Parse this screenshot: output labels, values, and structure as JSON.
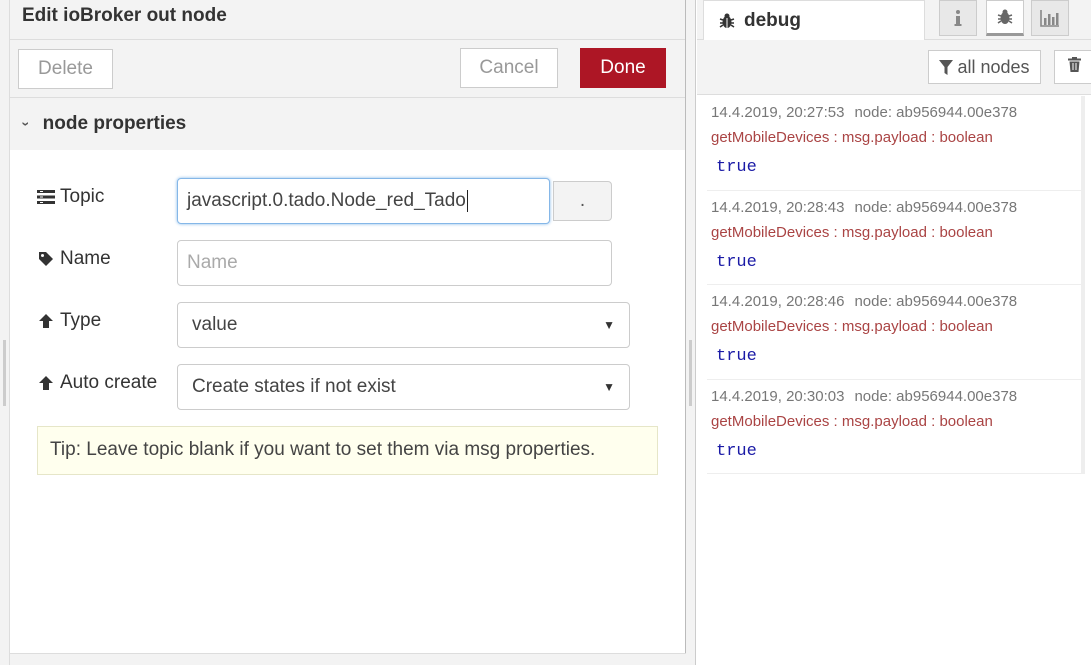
{
  "editor": {
    "title": "Edit ioBroker out node",
    "delete_label": "Delete",
    "cancel_label": "Cancel",
    "done_label": "Done",
    "section_title": "node properties",
    "fields": {
      "topic": {
        "label": "Topic",
        "value": "javascript.0.tado.Node_red_Tado",
        "button_label": "."
      },
      "name": {
        "label": "Name",
        "placeholder": "Name",
        "value": ""
      },
      "type": {
        "label": "Type",
        "value": "value"
      },
      "auto_create": {
        "label": "Auto create",
        "value": "Create states if not exist"
      }
    },
    "tip": "Tip: Leave topic blank if you want to set them via msg properties."
  },
  "sidebar": {
    "active_tab_label": "debug",
    "tab_icons": [
      "info-icon",
      "bug-icon",
      "chart-icon"
    ],
    "filter_label": "all nodes",
    "messages": [
      {
        "timestamp": "14.4.2019, 20:27:53",
        "node": "node: ab956944.00e378",
        "name": "getMobileDevices : msg.payload : boolean",
        "value": "true"
      },
      {
        "timestamp": "14.4.2019, 20:28:43",
        "node": "node: ab956944.00e378",
        "name": "getMobileDevices : msg.payload : boolean",
        "value": "true"
      },
      {
        "timestamp": "14.4.2019, 20:28:46",
        "node": "node: ab956944.00e378",
        "name": "getMobileDevices : msg.payload : boolean",
        "value": "true"
      },
      {
        "timestamp": "14.4.2019, 20:30:03",
        "node": "node: ab956944.00e378",
        "name": "getMobileDevices : msg.payload : boolean",
        "value": "true"
      }
    ]
  },
  "colors": {
    "done_button": "#ad1625",
    "tip_background": "#ffffee",
    "message_name": "#aa4444",
    "message_value": "#1a1aa6"
  }
}
